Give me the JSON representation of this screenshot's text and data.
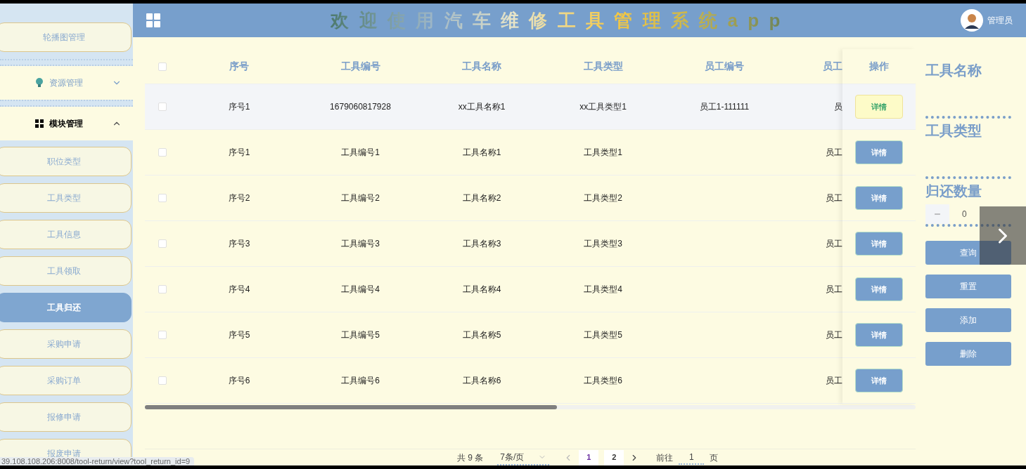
{
  "header": {
    "title": "欢迎使用汽车维修工具管理系统app",
    "user": "管理员"
  },
  "sidebar": {
    "items": [
      {
        "label": "轮播图管理",
        "kind": "link",
        "selected": false
      },
      {
        "label": "资源管理",
        "kind": "group",
        "expanded": false
      },
      {
        "label": "模块管理",
        "kind": "group",
        "expanded": true,
        "children": [
          {
            "label": "职位类型",
            "selected": false
          },
          {
            "label": "工具类型",
            "selected": false
          },
          {
            "label": "工具信息",
            "selected": false
          },
          {
            "label": "工具领取",
            "selected": false
          },
          {
            "label": "工具归还",
            "selected": true
          },
          {
            "label": "采购申请",
            "selected": false
          },
          {
            "label": "采购订单",
            "selected": false
          },
          {
            "label": "报修申请",
            "selected": false
          },
          {
            "label": "报废申请",
            "selected": false
          }
        ]
      }
    ]
  },
  "table": {
    "select_all_checked": false,
    "columns": [
      "序号",
      "工具编号",
      "工具名称",
      "工具类型",
      "员工编号",
      "员工"
    ],
    "action_column": "操作",
    "rows": [
      {
        "checked": false,
        "hovered": true,
        "cells": [
          "序号1",
          "1679060817928",
          "xx工具名称1",
          "xx工具类型1",
          "员工1-111111",
          "员"
        ],
        "action": "详情"
      },
      {
        "checked": false,
        "hovered": false,
        "cells": [
          "序号1",
          "工具编号1",
          "工具名称1",
          "工具类型1",
          "",
          "员工"
        ],
        "action": "详情"
      },
      {
        "checked": false,
        "hovered": false,
        "cells": [
          "序号2",
          "工具编号2",
          "工具名称2",
          "工具类型2",
          "",
          "员工"
        ],
        "action": "详情"
      },
      {
        "checked": false,
        "hovered": false,
        "cells": [
          "序号3",
          "工具编号3",
          "工具名称3",
          "工具类型3",
          "",
          "员工"
        ],
        "action": "详情"
      },
      {
        "checked": false,
        "hovered": false,
        "cells": [
          "序号4",
          "工具编号4",
          "工具名称4",
          "工具类型4",
          "",
          "员工"
        ],
        "action": "详情"
      },
      {
        "checked": false,
        "hovered": false,
        "cells": [
          "序号5",
          "工具编号5",
          "工具名称5",
          "工具类型5",
          "",
          "员工"
        ],
        "action": "详情"
      },
      {
        "checked": false,
        "hovered": false,
        "cells": [
          "序号6",
          "工具编号6",
          "工具名称6",
          "工具类型6",
          "",
          "员工"
        ],
        "action": "详情"
      }
    ]
  },
  "pagination": {
    "total": "共 9 条",
    "page_size": "7条/页",
    "pages": [
      {
        "label": "1",
        "selected": true
      },
      {
        "label": "2",
        "selected": false
      }
    ],
    "goto_label": "前往",
    "goto_value": "1",
    "page_unit": "页"
  },
  "form": {
    "fields": [
      {
        "label": "工具名称",
        "kind": "text"
      },
      {
        "label": "工具类型",
        "kind": "text"
      },
      {
        "label": "归还数量",
        "kind": "number",
        "value": "0"
      }
    ],
    "buttons": [
      "查询",
      "重置",
      "添加",
      "删除"
    ]
  },
  "status_url": "39.108.108.206:8008/tool-return/view?tool_return_id=9"
}
